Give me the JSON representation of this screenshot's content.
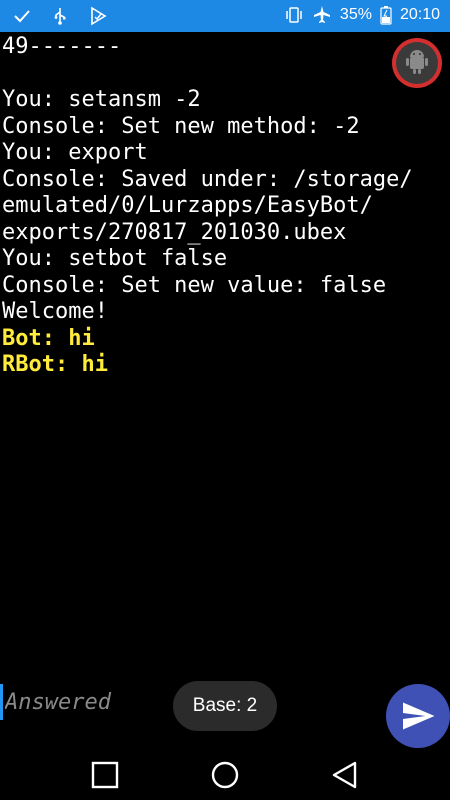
{
  "status_bar": {
    "battery_percent": "35%",
    "time": "20:10",
    "icons": [
      "check-icon",
      "usb-icon",
      "play-store-icon",
      "vibrate-icon",
      "airplane-icon",
      "battery-charging-icon"
    ]
  },
  "console": {
    "lines": [
      {
        "text": "49-------",
        "type": "normal"
      },
      {
        "text": "",
        "type": "normal"
      },
      {
        "text": "You: setansm -2",
        "type": "normal"
      },
      {
        "text": "Console: Set new method: -2",
        "type": "normal"
      },
      {
        "text": "You: export",
        "type": "normal"
      },
      {
        "text": "Console: Saved under: /storage/",
        "type": "normal"
      },
      {
        "text": "emulated/0/Lurzapps/EasyBot/",
        "type": "normal"
      },
      {
        "text": "exports/270817_201030.ubex",
        "type": "normal"
      },
      {
        "text": "You: setbot false",
        "type": "normal"
      },
      {
        "text": "Console: Set new value: false",
        "type": "normal"
      },
      {
        "text": "Welcome!",
        "type": "normal"
      },
      {
        "text": "Bot: hi",
        "type": "bot"
      },
      {
        "text": "RBot: hi",
        "type": "bot"
      }
    ]
  },
  "input": {
    "placeholder": "Answered",
    "value": ""
  },
  "toast": {
    "text": "Base: 2"
  },
  "colors": {
    "status_bar": "#1e88e5",
    "bot_text": "#ffeb3b",
    "send_button": "#3f51b5",
    "overlay_ring": "#d32f2f"
  }
}
